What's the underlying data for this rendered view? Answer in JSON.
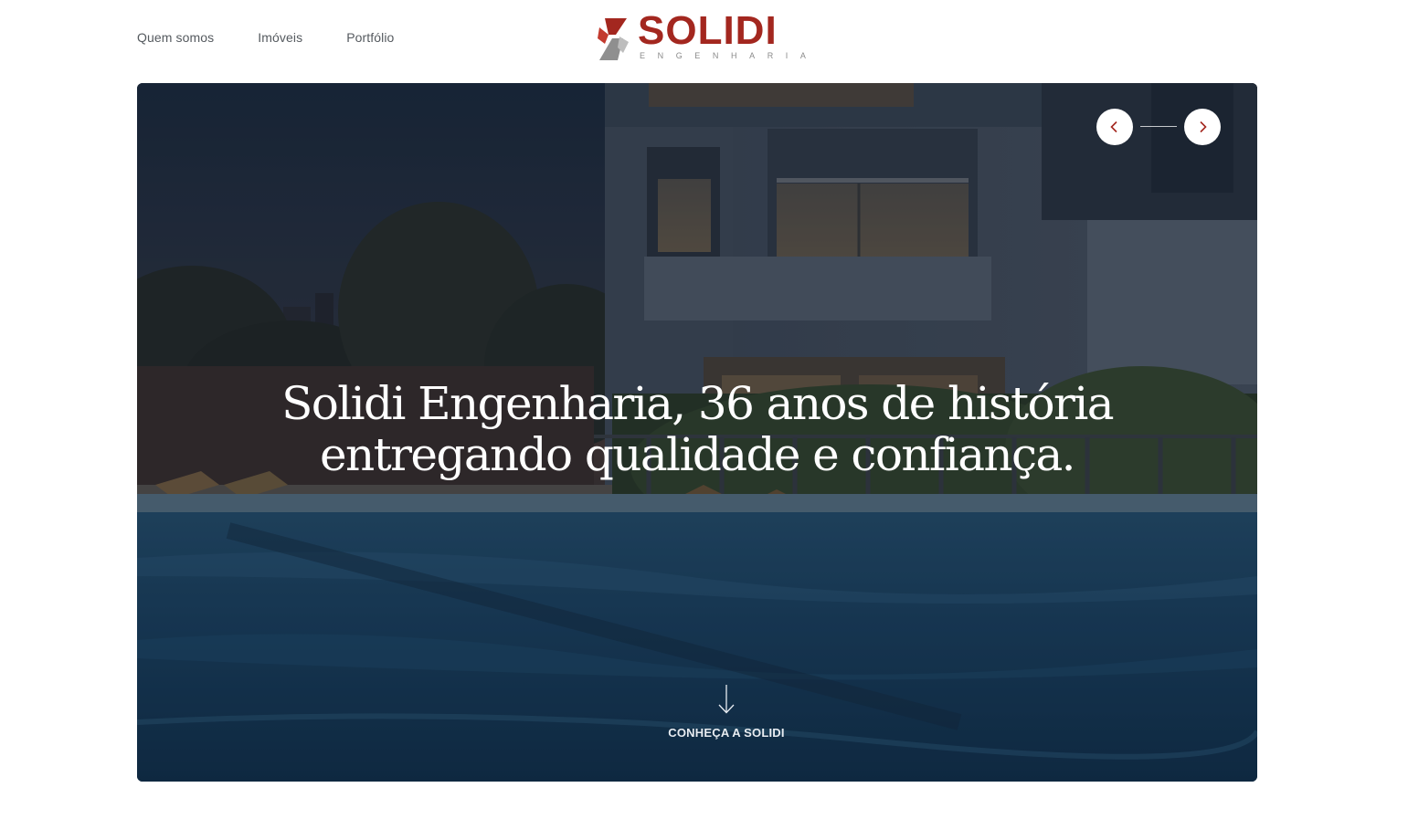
{
  "nav": {
    "items": [
      {
        "label": "Quem somos"
      },
      {
        "label": "Imóveis"
      },
      {
        "label": "Portfólio"
      }
    ]
  },
  "logo": {
    "word": "SOLIDI",
    "subtitle": "ENGENHARIA",
    "brand_color": "#a3271f",
    "icon": "solidi-s-mark-icon"
  },
  "hero": {
    "title": "Solidi Engenharia, 36 anos de história entregando qualidade e confiança.",
    "scroll_label": "CONHEÇA A SOLIDI",
    "scroll_icon": "arrow-down-icon",
    "prev_icon": "chevron-left-icon",
    "next_icon": "chevron-right-icon",
    "accent_color": "#a3271f"
  }
}
